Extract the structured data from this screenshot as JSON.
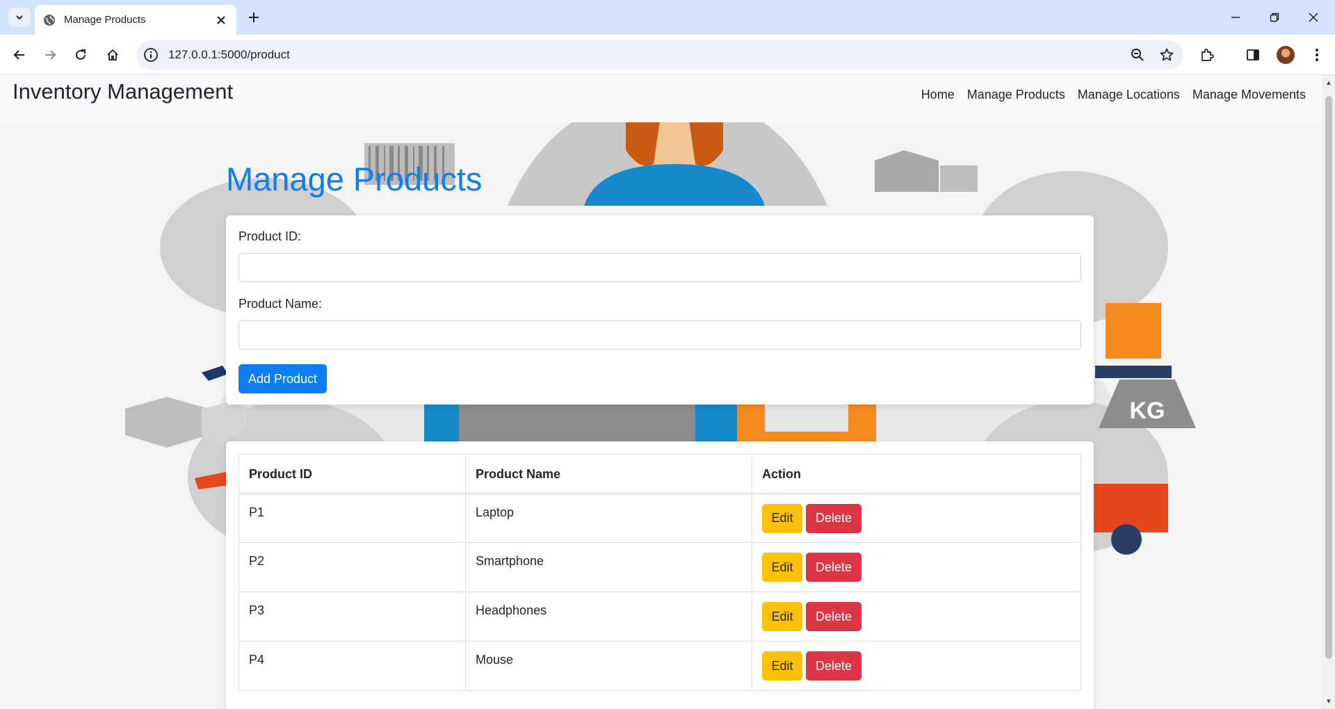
{
  "browser": {
    "tab_title": "Manage Products",
    "url": "127.0.0.1:5000/product"
  },
  "site": {
    "brand": "Inventory Management",
    "nav": [
      "Home",
      "Manage Products",
      "Manage Locations",
      "Manage Movements"
    ]
  },
  "page": {
    "heading": "Manage Products",
    "form": {
      "product_id_label": "Product ID:",
      "product_id_value": "",
      "product_name_label": "Product Name:",
      "product_name_value": "",
      "submit_label": "Add Product"
    },
    "table": {
      "headers": [
        "Product ID",
        "Product Name",
        "Action"
      ],
      "rows": [
        {
          "id": "P1",
          "name": "Laptop"
        },
        {
          "id": "P2",
          "name": "Smartphone"
        },
        {
          "id": "P3",
          "name": "Headphones"
        },
        {
          "id": "P4",
          "name": "Mouse"
        }
      ],
      "edit_label": "Edit",
      "delete_label": "Delete"
    }
  },
  "colors": {
    "primary": "#0d7ef2",
    "warning": "#ffc107",
    "danger": "#dc3545",
    "tabbar": "#d3e3fd"
  }
}
